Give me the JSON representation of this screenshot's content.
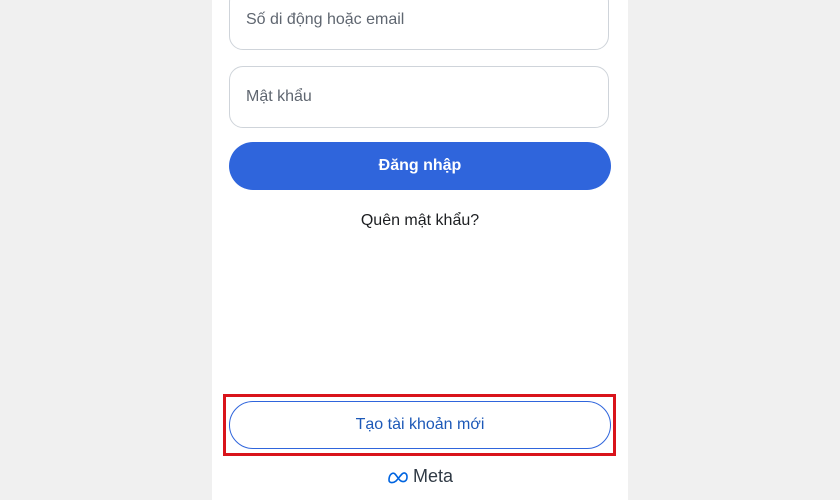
{
  "login": {
    "phone_email_placeholder": "Số di động hoặc email",
    "password_placeholder": "Mật khẩu",
    "login_button": "Đăng nhập",
    "forgot_password": "Quên mật khẩu?",
    "create_account_button": "Tạo tài khoản mới"
  },
  "brand": {
    "name": "Meta",
    "icon": "meta-infinity-icon",
    "color": "#0064e0"
  },
  "colors": {
    "primary": "#2f65dc",
    "highlight_box": "#d9141b",
    "background": "#f0f0f0"
  }
}
